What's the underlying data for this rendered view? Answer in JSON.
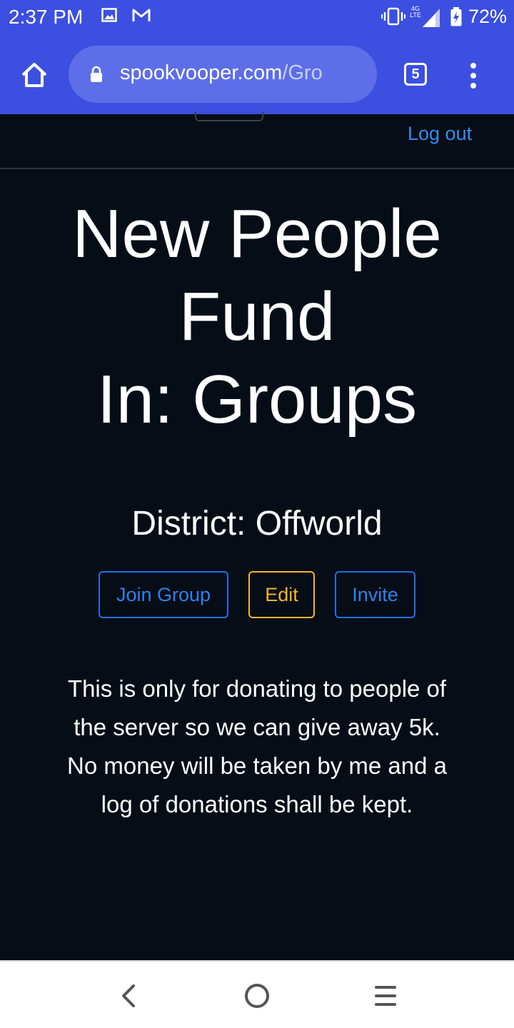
{
  "status_bar": {
    "time": "2:37 PM",
    "network": "4G LTE",
    "battery": "72%",
    "icons": [
      "gallery-icon",
      "gmail-icon",
      "vibrate-icon",
      "signal-icon",
      "battery-charging-icon"
    ]
  },
  "browser": {
    "url_host": "spookvooper.com",
    "url_path": "/Gro",
    "tab_count": "5",
    "icons": [
      "home-icon",
      "lock-icon",
      "more-vert-icon"
    ],
    "accent": "#3c4fe0"
  },
  "page": {
    "logout_label": "Log out",
    "title_line1": "New People",
    "title_line2": "Fund",
    "title_line3": "In: Groups",
    "district": "District: Offworld",
    "buttons": {
      "join": "Join Group",
      "edit": "Edit",
      "invite": "Invite"
    },
    "description": "This is only for donating to people of the server so we can give away 5k. No money will be taken by me and a log of donations shall be kept.",
    "colors": {
      "background": "#060d16",
      "link": "#2f8ef0",
      "primary_outline": "#1f6ef0",
      "warning_outline": "#f2b62a"
    }
  },
  "system_nav": {
    "icons": [
      "back-icon",
      "home-circle-icon",
      "recents-icon"
    ]
  }
}
